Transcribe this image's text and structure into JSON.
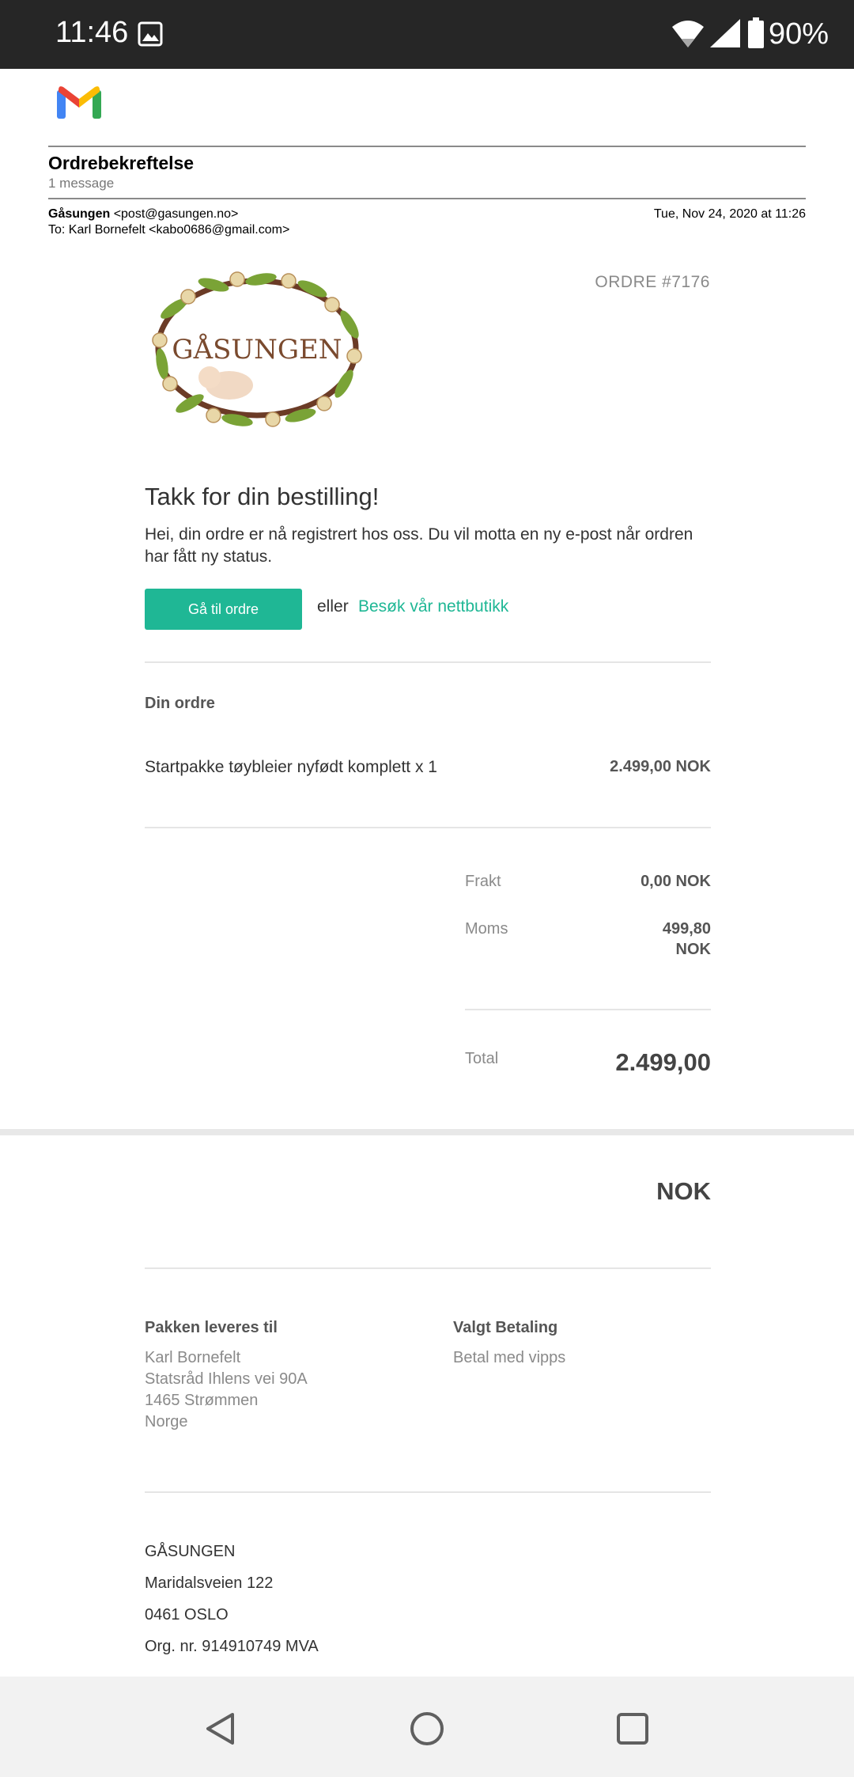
{
  "status_bar": {
    "time": "11:46",
    "battery_pct": "90%",
    "icons": [
      "image-icon",
      "wifi-icon",
      "signal-icon",
      "battery-icon"
    ]
  },
  "email": {
    "subject": "Ordrebekreftelse",
    "message_count": "1 message",
    "sender_name": "Gåsungen",
    "sender_email": "<post@gasungen.no>",
    "date": "Tue, Nov 24, 2020 at 11:26",
    "to_line": "To: Karl Bornefelt <kabo0686@gmail.com>"
  },
  "order": {
    "number": "ORDRE #7176",
    "logo_text": "GÅSUNGEN",
    "thanks": "Takk for din bestilling!",
    "intro": "Hei, din ordre er nå registrert hos oss. Du vil motta en ny e-post når ordren har fått ny status.",
    "button_label": "Gå til ordre",
    "or_text": "eller",
    "shop_link": "Besøk vår nettbutikk",
    "section_title": "Din ordre",
    "item_name": "Startpakke tøybleier nyfødt komplett  x 1",
    "item_price": "2.499,00 NOK",
    "shipping_label": "Frakt",
    "shipping_value": "0,00 NOK",
    "vat_label": "Moms",
    "vat_value_line1": "499,80",
    "vat_value_line2": "NOK",
    "total_label": "Total",
    "total_value": "2.499,00",
    "total_currency": "NOK"
  },
  "delivery": {
    "title": "Pakken leveres til",
    "lines": [
      "Karl Bornefelt",
      "Statsråd Ihlens vei 90A",
      "1465 Strømmen",
      "Norge"
    ]
  },
  "payment": {
    "title": "Valgt Betaling",
    "method": "Betal med vipps"
  },
  "company": {
    "name": "GÅSUNGEN",
    "address": "Maridalsveien 122",
    "city": "0461 OSLO",
    "org": "Org. nr. 914910749 MVA"
  },
  "colors": {
    "accent": "#1fb795",
    "status_bar": "#262626",
    "nav_bar": "#f2f2f2"
  }
}
